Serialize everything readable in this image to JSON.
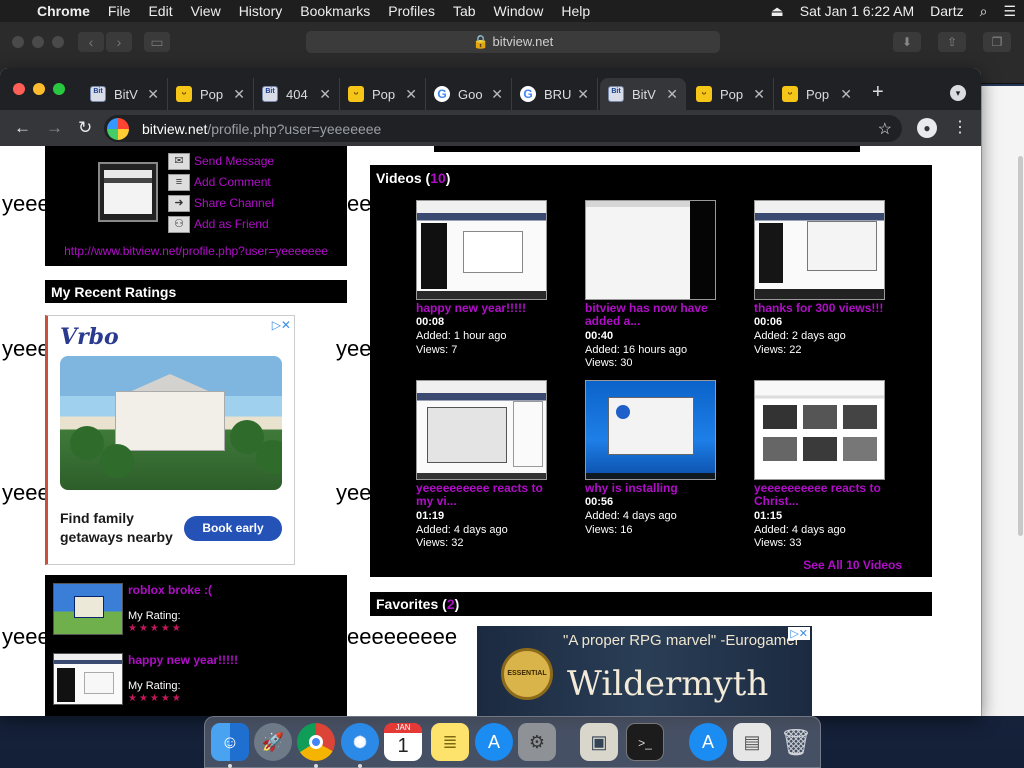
{
  "menubar": {
    "apple": "",
    "app": "Chrome",
    "items": [
      "File",
      "Edit",
      "View",
      "History",
      "Bookmarks",
      "Profiles",
      "Tab",
      "Window",
      "Help"
    ],
    "clock": "Sat Jan 1  6:22 AM",
    "user": "Dartz"
  },
  "bg_window": {
    "url": "bitview.net"
  },
  "tabs": [
    {
      "title": "BitV",
      "icon": "bitview-favicon",
      "active": false
    },
    {
      "title": "Pop",
      "icon": "popcat-favicon",
      "active": false
    },
    {
      "title": "404",
      "icon": "bitview-favicon",
      "active": false
    },
    {
      "title": "Pop",
      "icon": "popcat-favicon",
      "active": false
    },
    {
      "title": "Goo",
      "icon": "google-favicon",
      "active": false
    },
    {
      "title": "BRU",
      "icon": "google-favicon",
      "active": false
    },
    {
      "title": "BitV",
      "icon": "bitview-favicon",
      "active": true
    },
    {
      "title": "Pop",
      "icon": "popcat-favicon",
      "active": false
    },
    {
      "title": "Pop",
      "icon": "popcat-favicon",
      "active": false
    }
  ],
  "address": {
    "host": "bitview.net",
    "path": "/profile.php?user=yeeeeeee"
  },
  "background_text": "yeeeeeeeee",
  "channel": {
    "actions": [
      "Send Message",
      "Add Comment",
      "Share Channel",
      "Add as Friend"
    ],
    "profile_url": "http://www.bitview.net/profile.php?user=yeeeeeee"
  },
  "ratings_section": {
    "title": "My Recent Ratings"
  },
  "ad_vrbo": {
    "brand": "Vrbo",
    "headline": "Find family getaways nearby",
    "button": "Book early",
    "close": "▷✕"
  },
  "ratings": [
    {
      "title": "roblox broke :(",
      "label": "My Rating:",
      "stars": "★★★★★"
    },
    {
      "title": "happy new year!!!!!",
      "label": "My Rating:",
      "stars": "★★★★★"
    }
  ],
  "videos_section": {
    "title": "Videos",
    "count": "10",
    "see_all": "See All 10 Videos"
  },
  "videos": [
    {
      "title": "happy new year!!!!!",
      "duration": "00:08",
      "added": "Added: 1 hour ago",
      "views": "Views: 7"
    },
    {
      "title": "bitview has now have added a...",
      "duration": "00:40",
      "added": "Added: 16 hours ago",
      "views": "Views: 30"
    },
    {
      "title": "thanks for 300 views!!!",
      "duration": "00:06",
      "added": "Added: 2 days ago",
      "views": "Views: 22"
    },
    {
      "title": "yeeeeeeeeee reacts to my vi...",
      "duration": "01:19",
      "added": "Added: 4 days ago",
      "views": "Views: 32"
    },
    {
      "title": "why is installing",
      "duration": "00:56",
      "added": "Added: 4 days ago",
      "views": "Views: 16"
    },
    {
      "title": "yeeeeeeeeee reacts to Christ...",
      "duration": "01:15",
      "added": "Added: 4 days ago",
      "views": "Views: 33"
    }
  ],
  "favorites_section": {
    "title": "Favorites",
    "count": "2"
  },
  "ad_game": {
    "quote": "\"A proper RPG marvel\" -Eurogamer",
    "logo": "Wildermyth",
    "badge": "ESSENTIAL"
  },
  "dock": [
    "finder-icon",
    "launchpad-icon",
    "chrome-icon",
    "safari-icon",
    "calendar-icon",
    "notes-icon",
    "app-store-icon",
    "system-preferences-icon",
    "preview-icon",
    "terminal-icon",
    "app-store-icon",
    "file-icon",
    "trash-icon"
  ],
  "dock_calendar": {
    "month": "JAN",
    "day": "1"
  }
}
